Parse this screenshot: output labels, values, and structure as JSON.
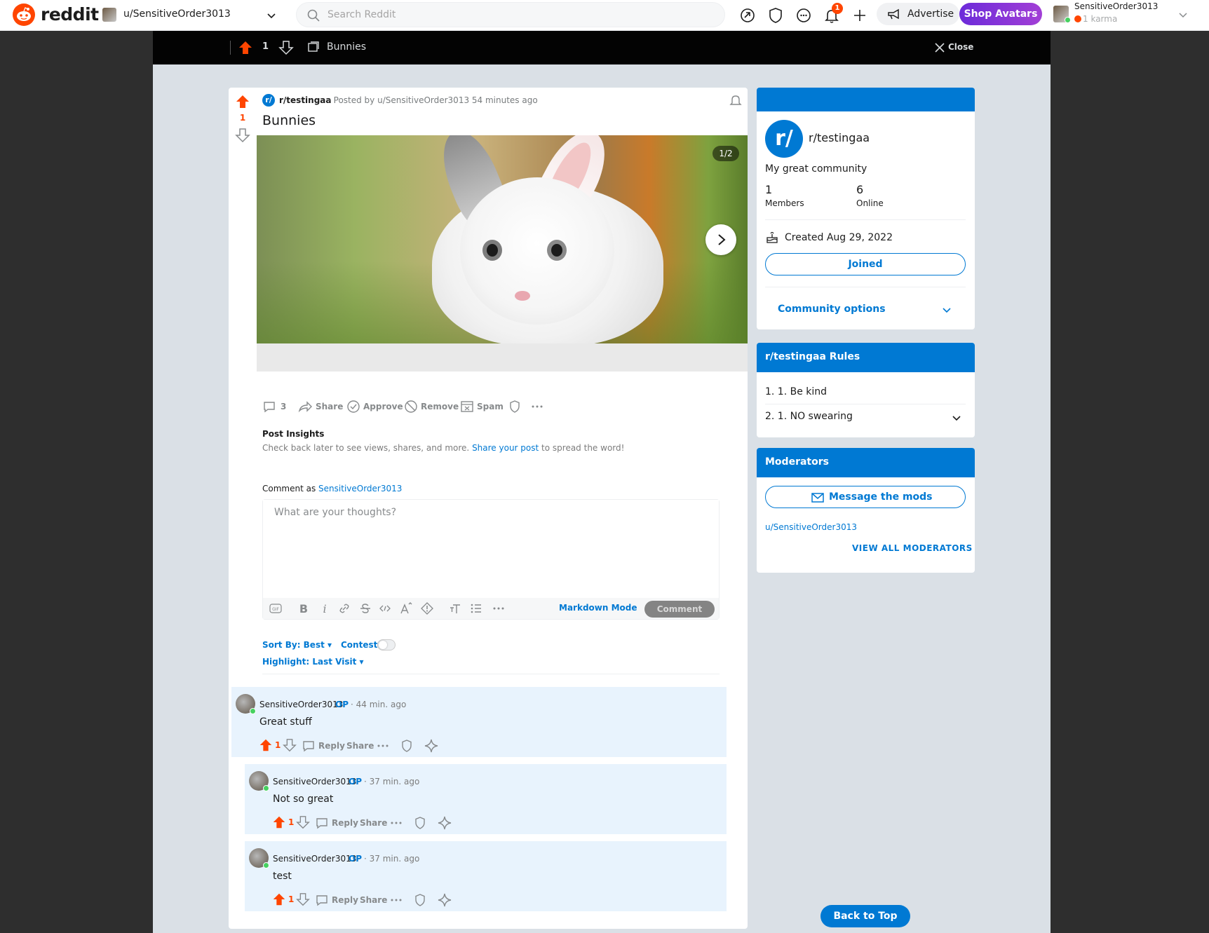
{
  "header": {
    "wordmark": "reddit",
    "current_feed": "u/SensitiveOrder3013",
    "search_placeholder": "Search Reddit",
    "notification_count": "1",
    "advertise_label": "Advertise",
    "shop_label": "Shop Avatars",
    "username": "SensitiveOrder3013",
    "karma": "1 karma"
  },
  "topbar": {
    "score": "1",
    "title": "Bunnies",
    "close_label": "Close"
  },
  "post": {
    "subreddit": "r/testingaa",
    "subreddit_icon": "r/",
    "meta": "· Posted by u/SensitiveOrder3013 54 minutes ago",
    "score": "1",
    "title": "Bunnies",
    "gallery_counter": "1/2",
    "actions": {
      "comments": "3",
      "share": "Share",
      "approve": "Approve",
      "remove": "Remove",
      "spam": "Spam"
    },
    "insights": {
      "title": "Post Insights",
      "text_before": "Check back later to see views, shares, and more.",
      "link": "Share your post",
      "text_after": "to spread the word!"
    }
  },
  "composer": {
    "comment_as_label": "Comment as",
    "comment_as_user": "SensitiveOrder3013",
    "placeholder": "What are your thoughts?",
    "markdown_mode": "Markdown Mode",
    "submit_label": "Comment"
  },
  "sort": {
    "sort_by": "Sort By: Best",
    "contest": "Contest",
    "highlight": "Highlight: Last Visit"
  },
  "comments": [
    {
      "author": "SensitiveOrder3013",
      "op": "OP",
      "time": "· 44 min. ago",
      "body": "Great stuff",
      "score": "1",
      "reply": "Reply",
      "share": "Share"
    },
    {
      "author": "SensitiveOrder3013",
      "op": "OP",
      "time": "· 37 min. ago",
      "body": "Not so great",
      "score": "1",
      "reply": "Reply",
      "share": "Share"
    },
    {
      "author": "SensitiveOrder3013",
      "op": "OP",
      "time": "· 37 min. ago",
      "body": "test",
      "score": "1",
      "reply": "Reply",
      "share": "Share"
    }
  ],
  "sidebar": {
    "about": {
      "icon": "r/",
      "name": "r/testingaa",
      "description": "My great community",
      "members_count": "1",
      "members_label": "Members",
      "online_count": "6",
      "online_label": "Online",
      "created": "Created Aug 29, 2022",
      "joined_label": "Joined",
      "community_options": "Community options"
    },
    "rules": {
      "title": "r/testingaa Rules",
      "items": [
        "1. 1. Be kind",
        "2. 1. NO swearing"
      ]
    },
    "moderators": {
      "title": "Moderators",
      "message_label": "Message the mods",
      "mod": "u/SensitiveOrder3013",
      "view_all": "VIEW ALL MODERATORS"
    },
    "back_to_top": "Back to Top"
  },
  "colors": {
    "brand": "#ff4500",
    "accent": "#0079d3",
    "comment_highlight": "#e8f3fd"
  }
}
